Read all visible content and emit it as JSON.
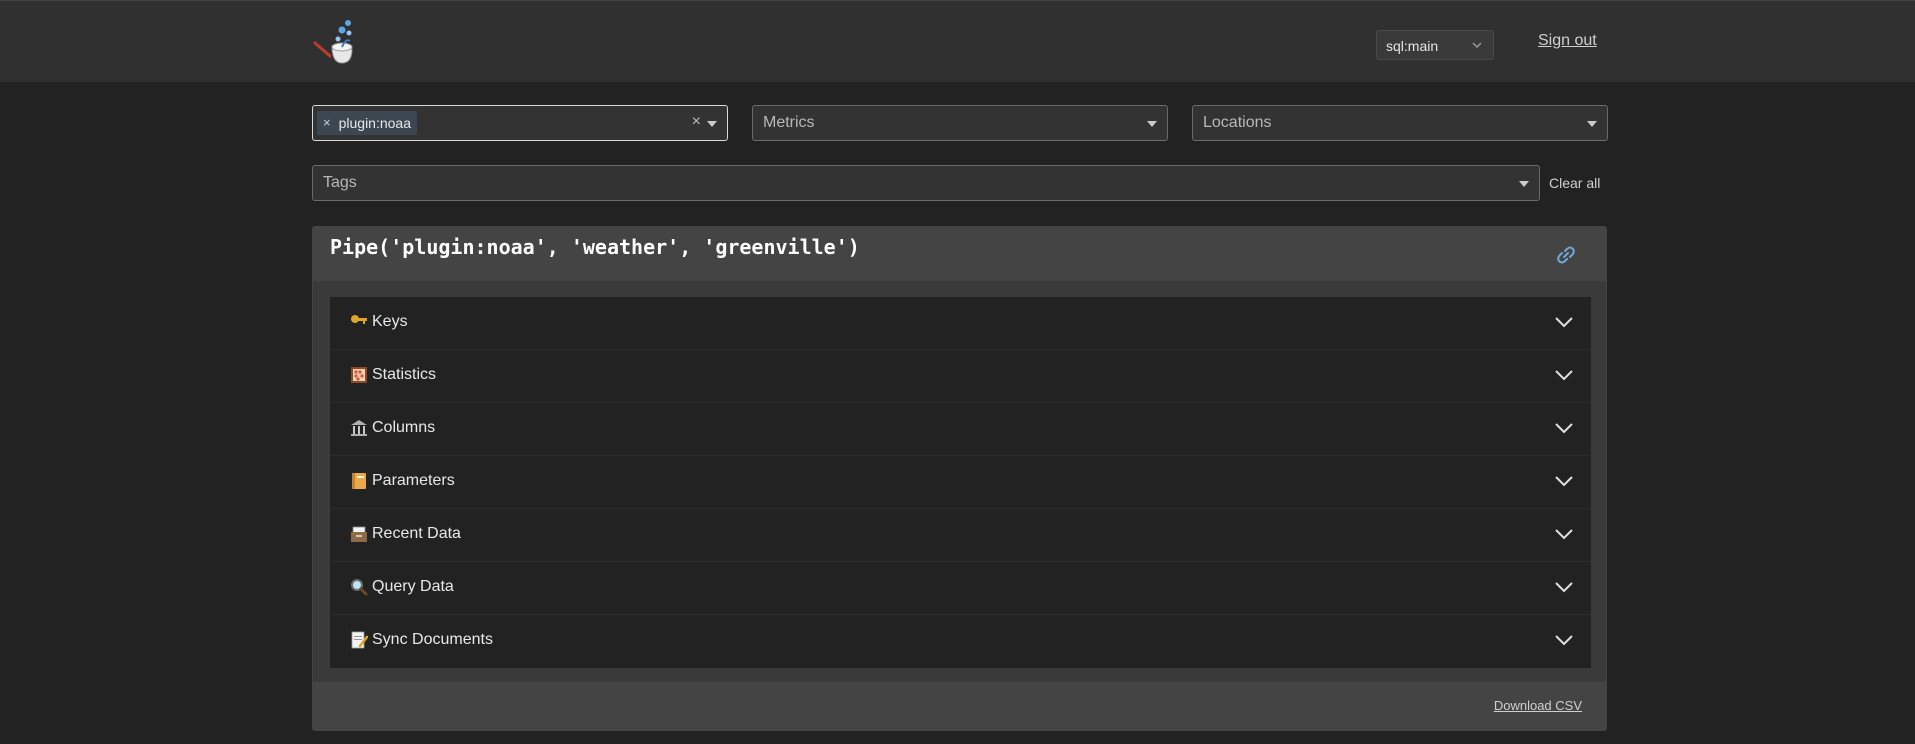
{
  "header": {
    "logo_icon": "meerschaum-pipe-logo-icon",
    "instance": "sql:main",
    "signout_label": "Sign out"
  },
  "filters": {
    "connector": {
      "chip": "plugin:noaa",
      "chip_remove": "×",
      "clear": "×"
    },
    "metrics": {
      "placeholder": "Metrics"
    },
    "locations": {
      "placeholder": "Locations"
    },
    "tags": {
      "placeholder": "Tags"
    },
    "clear_all_label": "Clear all"
  },
  "pipe_card": {
    "title": "Pipe('plugin:noaa', 'weather', 'greenville')",
    "link_icon": "link-icon",
    "sections": [
      {
        "icon": "key-icon",
        "label": "Keys"
      },
      {
        "icon": "abacus-icon",
        "label": "Statistics"
      },
      {
        "icon": "classical-building-icon",
        "label": "Columns"
      },
      {
        "icon": "notebook-icon",
        "label": "Parameters"
      },
      {
        "icon": "card-file-box-icon",
        "label": "Recent Data"
      },
      {
        "icon": "magnifier-icon",
        "label": "Query Data"
      },
      {
        "icon": "memo-icon",
        "label": "Sync Documents"
      }
    ],
    "download_label": "Download CSV"
  },
  "colors": {
    "background": "#222222",
    "topbar": "#303030",
    "card": "#3a3a3a",
    "card_header": "#444444",
    "chip": "#3c4752"
  }
}
